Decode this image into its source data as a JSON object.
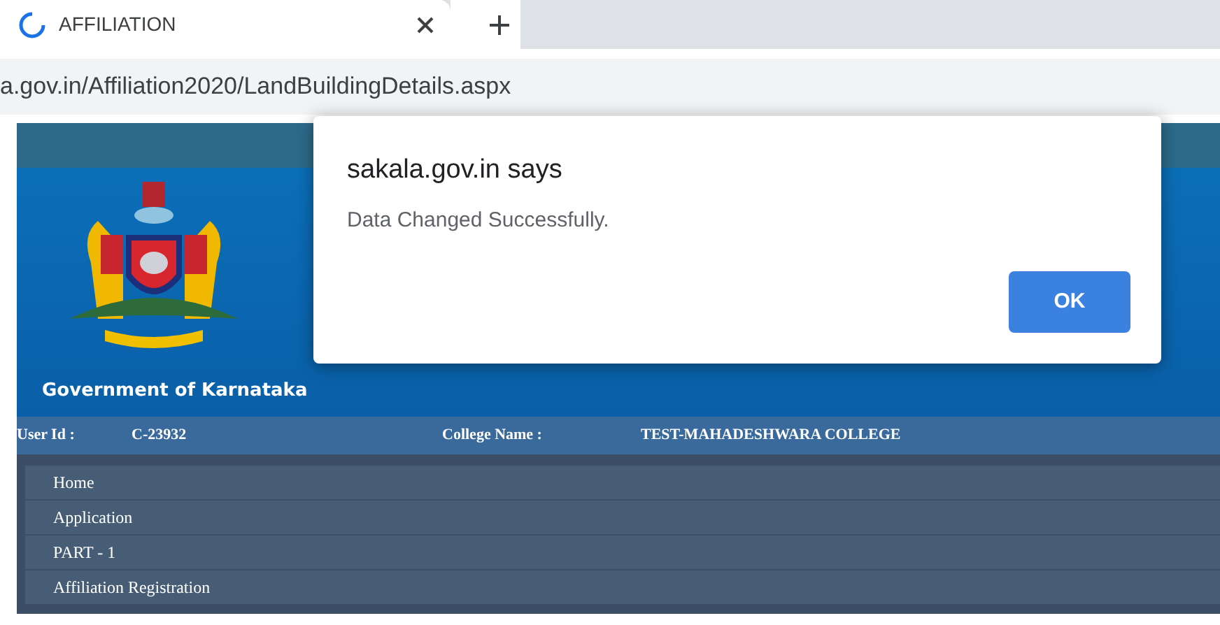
{
  "browser": {
    "tab": {
      "title": "AFFILIATION",
      "loading": true
    },
    "address": "a.gov.in/Affiliation2020/LandBuildingDetails.aspx"
  },
  "header": {
    "caption": "Government of Karnataka"
  },
  "user_bar": [
    {
      "label": "User Id :",
      "value": "C-23932"
    },
    {
      "label": "College Name :",
      "value": "TEST-MAHADESHWARA COLLEGE"
    }
  ],
  "menu": [
    "Home",
    "Application",
    "PART - 1",
    "Affiliation Registration"
  ],
  "dialog": {
    "title": "sakala.gov.in says",
    "message": "Data Changed Successfully.",
    "button": "OK"
  }
}
